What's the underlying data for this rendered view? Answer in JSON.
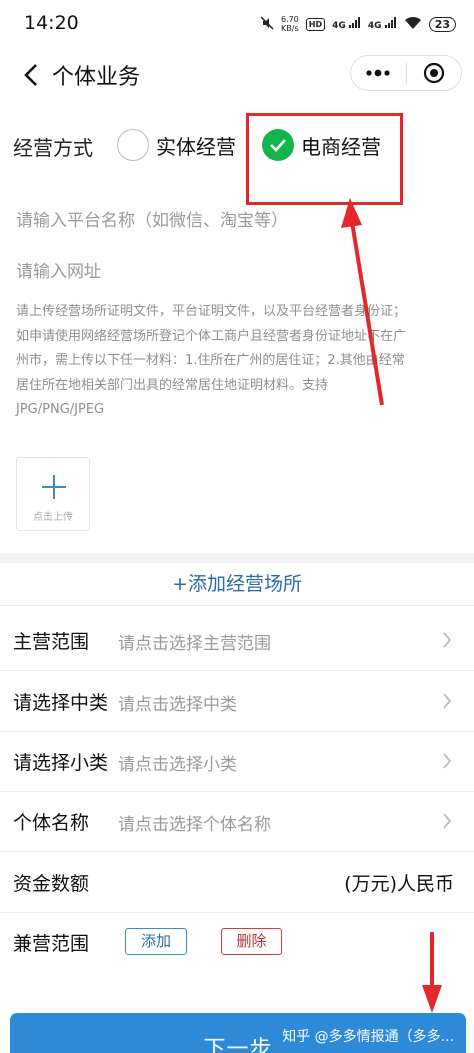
{
  "status_bar": {
    "time": "14:20",
    "net_speed": "6.70",
    "net_unit": "KB/s",
    "hd": "HD",
    "signal1": "4G",
    "signal2": "4G",
    "battery": "23"
  },
  "nav": {
    "title": "个体业务",
    "icons": [
      "back-icon",
      "more-icon",
      "close-target-icon"
    ]
  },
  "business_mode": {
    "label": "经营方式",
    "options": [
      {
        "label": "实体经营",
        "selected": false
      },
      {
        "label": "电商经营",
        "selected": true
      }
    ]
  },
  "platform": {
    "name_placeholder": "请输入平台名称（如微信、淘宝等）",
    "url_placeholder": "请输入网址"
  },
  "upload": {
    "note_lines": [
      "请上传经营场所证明文件，平台证明文件，以及平台经营者身份证；",
      "如申请使用网络经营场所登记个体工商户且经营者身份证地址不在广",
      "州市，需上传以下任一材料：1.住所在广州的居住证；2.其他由经常",
      "居住所在地相关部门出具的经常居住地证明材料。支持",
      "JPG/PNG/JPEG"
    ],
    "button_label": "点击上传"
  },
  "add_place": "+添加经营场所",
  "form": {
    "main_scope": {
      "label": "主营范围",
      "placeholder": "请点击选择主营范围"
    },
    "mid_category": {
      "label": "请选择中类",
      "placeholder": "请点击选择中类"
    },
    "sub_category": {
      "label": "请选择小类",
      "placeholder": "请点击选择小类"
    },
    "entity_name": {
      "label": "个体名称",
      "placeholder": "请点击选择个体名称"
    },
    "capital": {
      "label": "资金数额",
      "unit": "(万元)人民币"
    },
    "side_scope": {
      "label": "兼营范围",
      "add": "添加",
      "delete": "删除"
    }
  },
  "next_button": "下一步",
  "watermark": "知乎 @多多情报通（多多...",
  "colors": {
    "accent_blue": "#2d8ad8",
    "link_blue": "#2b6ca8",
    "check_green": "#12b54a",
    "highlight_red": "#e3282b"
  }
}
